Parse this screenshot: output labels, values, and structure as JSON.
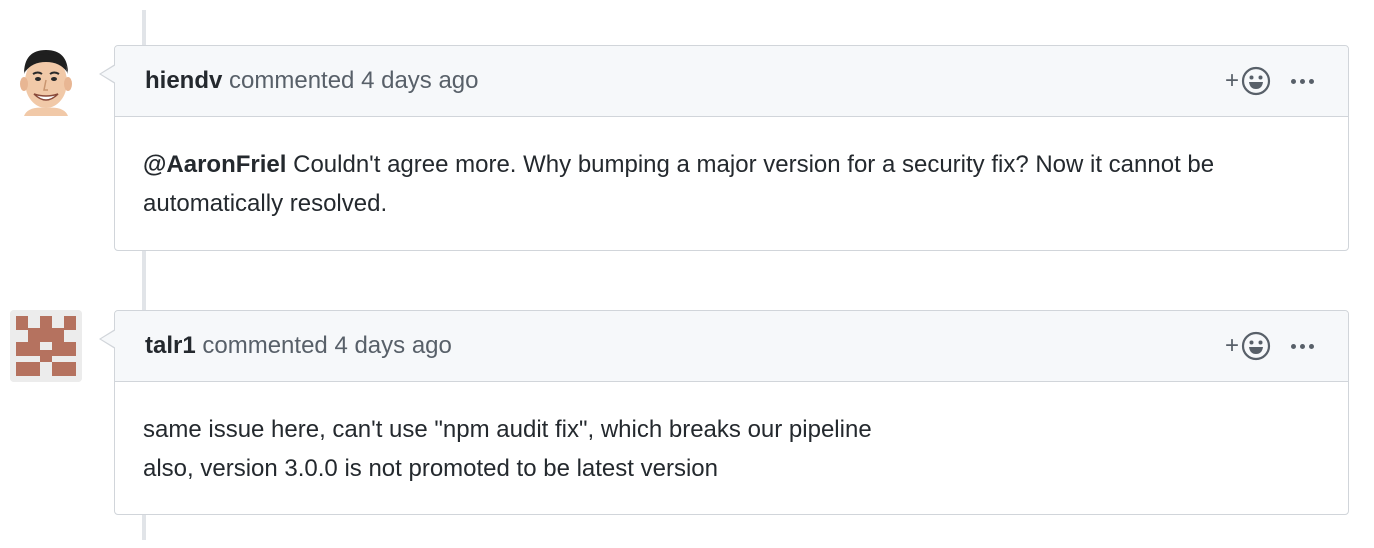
{
  "comments": [
    {
      "author": "hiendv",
      "action": "commented",
      "time": "4 days ago",
      "avatar_icon": "cartoon-face-avatar",
      "mention": "@AaronFriel",
      "body_text": " Couldn't agree more. Why bumping a major version for a security fix? Now it cannot be automatically resolved.",
      "reaction_plus": "+",
      "reaction_icon": "smiley-icon",
      "more_icon": "kebab-horizontal-icon"
    },
    {
      "author": "talr1",
      "action": "commented",
      "time": "4 days ago",
      "avatar_icon": "identicon-avatar",
      "body_lines": [
        "same issue here, can't use \"npm audit fix\", which breaks our pipeline",
        "also, version 3.0.0 is not promoted to be latest version"
      ],
      "reaction_plus": "+",
      "reaction_icon": "smiley-icon",
      "more_icon": "kebab-horizontal-icon"
    }
  ],
  "colors": {
    "header_bg": "#f6f8fa",
    "border": "#d1d5da",
    "text": "#24292e",
    "muted": "#586069",
    "identicon": "#b5725f"
  }
}
